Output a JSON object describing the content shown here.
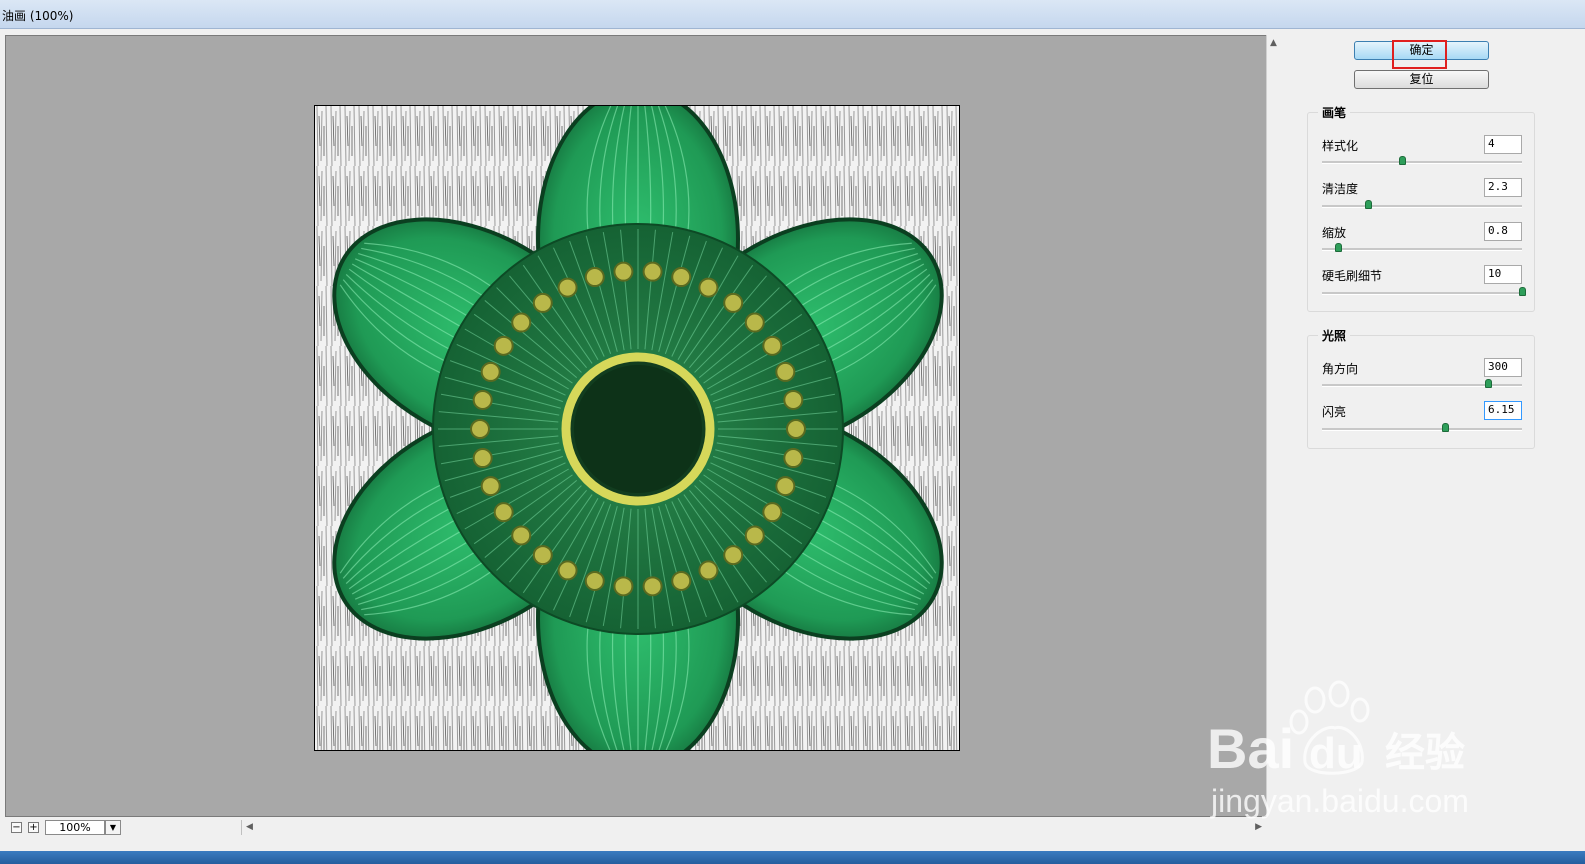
{
  "window": {
    "title": "油画 (100%)"
  },
  "buttons": {
    "ok": "确定",
    "reset": "复位"
  },
  "brush": {
    "title": "画笔",
    "params": [
      {
        "label": "样式化",
        "value": "4",
        "slider_fraction": 0.4
      },
      {
        "label": "清洁度",
        "value": "2.3",
        "slider_fraction": 0.23
      },
      {
        "label": "缩放",
        "value": "0.8",
        "slider_fraction": 0.08
      },
      {
        "label": "硬毛刷细节",
        "value": "10",
        "slider_fraction": 1.0
      }
    ]
  },
  "lighting": {
    "title": "光照",
    "params": [
      {
        "label": "角方向",
        "value": "300",
        "slider_fraction": 0.83
      },
      {
        "label": "闪亮",
        "value": "6.15",
        "slider_fraction": 0.615
      }
    ]
  },
  "zoom": {
    "value": "100%",
    "minus": "−",
    "plus": "+"
  },
  "watermark": {
    "brand": "Bai",
    "brand_cn": "经验",
    "url": "jingyan.baidu.com"
  },
  "colors": {
    "accent": "#3c7fb1",
    "highlight": "#e02020",
    "petal": "#1f9a55"
  }
}
